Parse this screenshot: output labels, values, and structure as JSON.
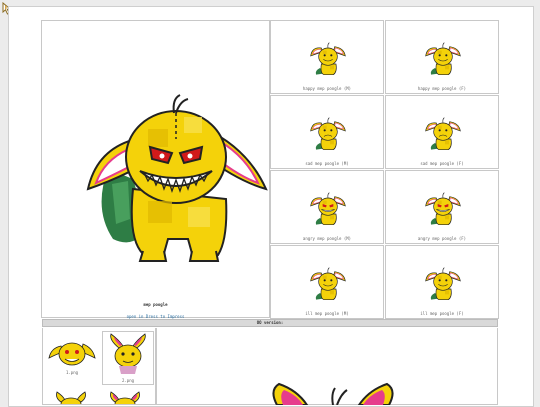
{
  "main": {
    "name": "mep poogle",
    "link": "open in Dress to Impress"
  },
  "grid": [
    {
      "caption": "happy mep poogle (M)"
    },
    {
      "caption": "happy mep poogle (F)"
    },
    {
      "caption": "sad mep poogle (M)"
    },
    {
      "caption": "sad mep poogle (F)"
    },
    {
      "caption": "angry mep poogle (M)"
    },
    {
      "caption": "angry mep poogle (F)"
    },
    {
      "caption": "ill mep poogle (M)"
    },
    {
      "caption": "ill mep poogle (F)"
    }
  ],
  "oo": {
    "header": "OO version:",
    "thumbs": [
      {
        "caption": "1.png"
      },
      {
        "caption": "2.png"
      }
    ]
  },
  "icons": {
    "cursor": "arrow-cursor-icon"
  },
  "colors": {
    "body_yellow": "#f4d20a",
    "body_shadow": "#c9a100",
    "ear_pink": "#e63c8c",
    "cape_green": "#2e7d45",
    "eye_red": "#d11a1a",
    "link": "#2a6ea0"
  }
}
